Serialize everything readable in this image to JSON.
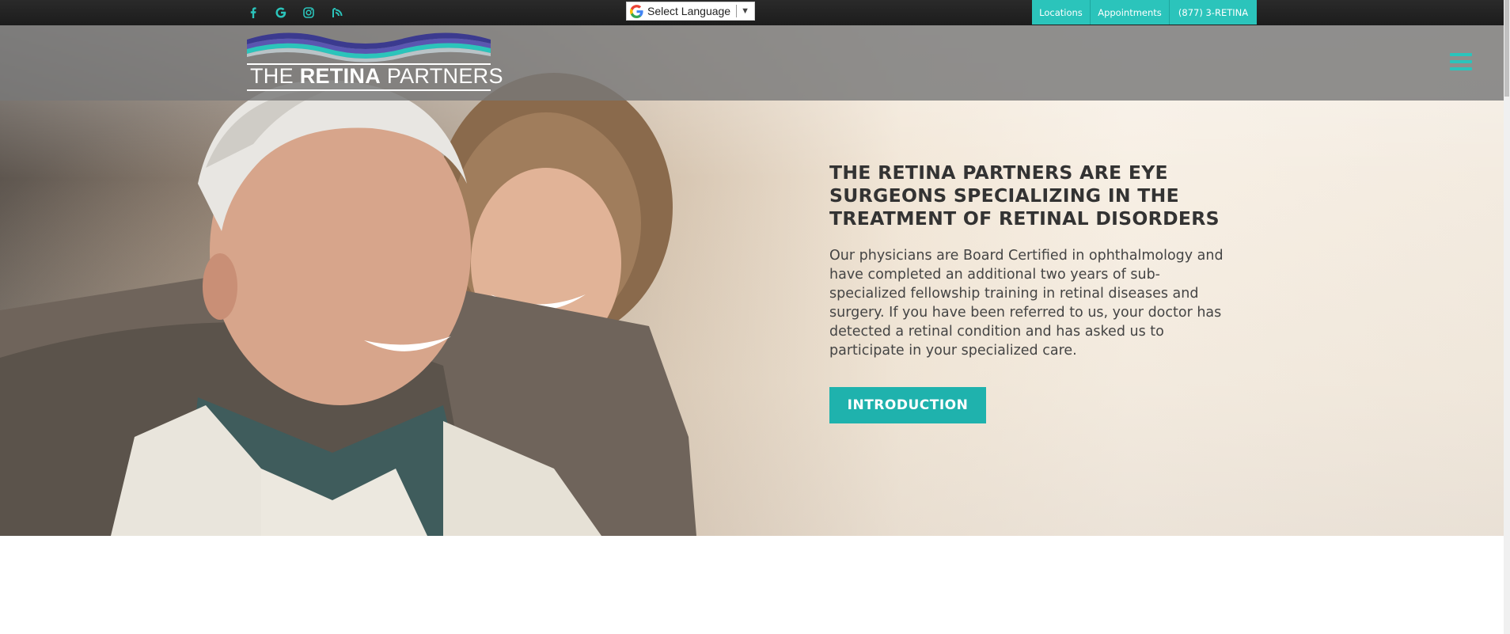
{
  "social": {
    "icons": [
      "facebook-icon",
      "google-icon",
      "instagram-icon",
      "review-icon"
    ],
    "color": "#2bc4bb"
  },
  "translate": {
    "label": "Select Language",
    "arrow": "▼"
  },
  "top_links": {
    "locations": "Locations",
    "appointments": "Appointments",
    "phone": "(877) 3-RETINA"
  },
  "logo": {
    "word1": "THE ",
    "word2": "RETINA",
    "word3": " PARTNERS"
  },
  "hero": {
    "title": "THE RETINA PARTNERS ARE EYE SURGEONS SPECIALIZING IN THE TREATMENT OF RETINAL DISORDERS",
    "body": "Our physicians are Board Certified in ophthalmology and have completed an additional two years of sub-specialized fellowship training in retinal diseases and surgery. If you have been referred to us, your doctor has detected a retinal condition and has asked us to participate in your specialized care.",
    "button": "INTRODUCTION"
  },
  "colors": {
    "accent": "#2bc4bb",
    "button": "#1fb2ad",
    "topbar": "#222222",
    "header": "#787878"
  }
}
